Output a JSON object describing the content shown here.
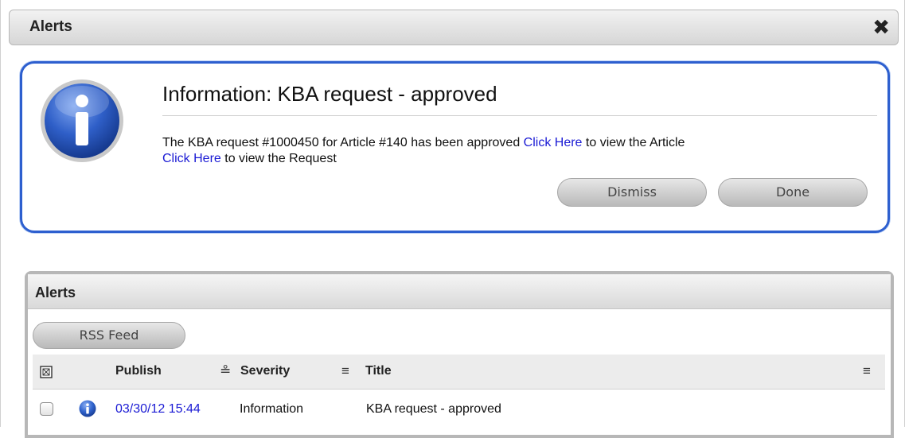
{
  "window": {
    "title": "Alerts",
    "close_glyph": "✖"
  },
  "alert": {
    "icon": "info-icon",
    "title": "Information: KBA request - approved",
    "message_part1": "The KBA request #1000450 for Article #140 has been approved ",
    "link1": "Click Here",
    "message_part2": " to view the Article",
    "link2": "Click Here",
    "message_part3": " to view the Request",
    "dismiss_label": "Dismiss",
    "done_label": "Done"
  },
  "list": {
    "title": "Alerts",
    "rss_label": "RSS Feed",
    "columns": {
      "publish": "Publish",
      "severity": "Severity",
      "title": "Title"
    },
    "rows": [
      {
        "icon": "info-icon",
        "publish": "03/30/12 15:44",
        "severity": "Information",
        "title": "KBA request - approved"
      }
    ]
  },
  "colors": {
    "accent_blue": "#2d5fcf",
    "link": "#1a1ad4"
  }
}
